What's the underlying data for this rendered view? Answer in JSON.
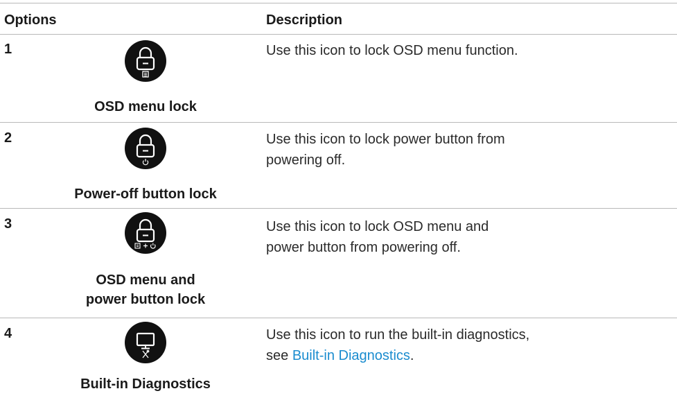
{
  "table": {
    "headers": {
      "options": "Options",
      "description": "Description"
    },
    "rows": [
      {
        "number": "1",
        "icon": "lock-menu-icon",
        "caption": "OSD menu lock",
        "description": "Use this icon to lock OSD menu function."
      },
      {
        "number": "2",
        "icon": "lock-power-icon",
        "caption": "Power-off button lock",
        "description": "Use this icon to lock power button from powering off."
      },
      {
        "number": "3",
        "icon": "lock-menu-power-icon",
        "caption": "OSD menu and power button lock",
        "description": "Use this icon to lock OSD menu and power button from powering off."
      },
      {
        "number": "4",
        "icon": "monitor-tools-icon",
        "caption": "Built-in Diagnostics",
        "description_prefix": "Use this icon to run the built-in diagnostics, see ",
        "description_link": "Built-in Diagnostics",
        "description_suffix": "."
      }
    ]
  },
  "colors": {
    "icon_bg": "#111111",
    "link": "#1a8ccf",
    "rule": "#b8b8b8"
  }
}
